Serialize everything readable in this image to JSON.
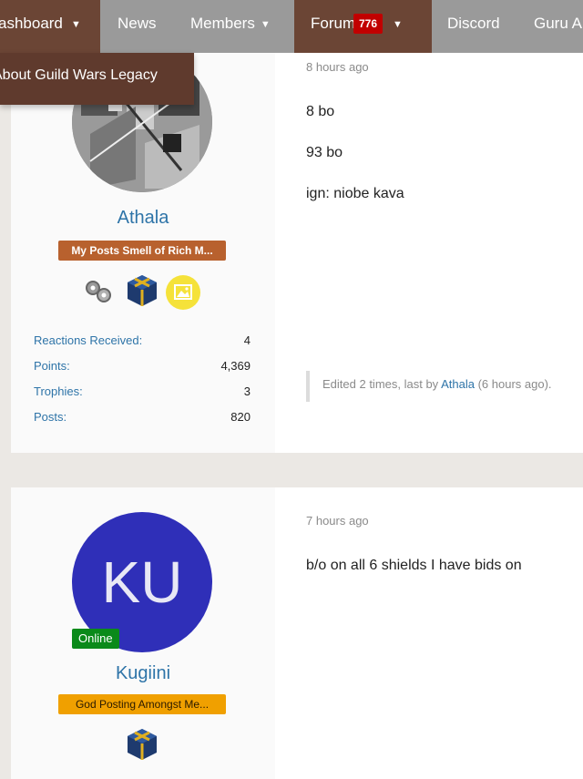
{
  "nav": {
    "dashboard_label": "ashboard",
    "news_label": "News",
    "members_label": "Members",
    "forum_label": "Forum",
    "forum_badge": "776",
    "discord_label": "Discord",
    "guru_label": "Guru A",
    "active_color": "#6b4535"
  },
  "dropdown": {
    "about_label": "About Guild Wars Legacy"
  },
  "posts": [
    {
      "timestamp": "8 hours ago",
      "username": "Athala",
      "user_title": "My Posts Smell of Rich M...",
      "user_title_color": "#b8612e",
      "stats": [
        {
          "label": "Reactions Received:",
          "value": "4"
        },
        {
          "label": "Points:",
          "value": "4,369"
        },
        {
          "label": "Trophies:",
          "value": "3"
        },
        {
          "label": "Posts:",
          "value": "820"
        }
      ],
      "body": [
        "8 bo",
        "93 bo",
        "ign: niobe kava"
      ],
      "edit_prefix": "Edited 2 times, last by",
      "edit_user": "Athala",
      "edit_suffix": "(6 hours ago)."
    },
    {
      "timestamp": "7 hours ago",
      "username": "Kugiini",
      "avatar_initials": "KU",
      "online_label": "Online",
      "user_title": "God Posting Amongst Me...",
      "user_title_color": "#f0a000",
      "body": [
        "b/o on all 6 shields I have bids on"
      ]
    }
  ]
}
